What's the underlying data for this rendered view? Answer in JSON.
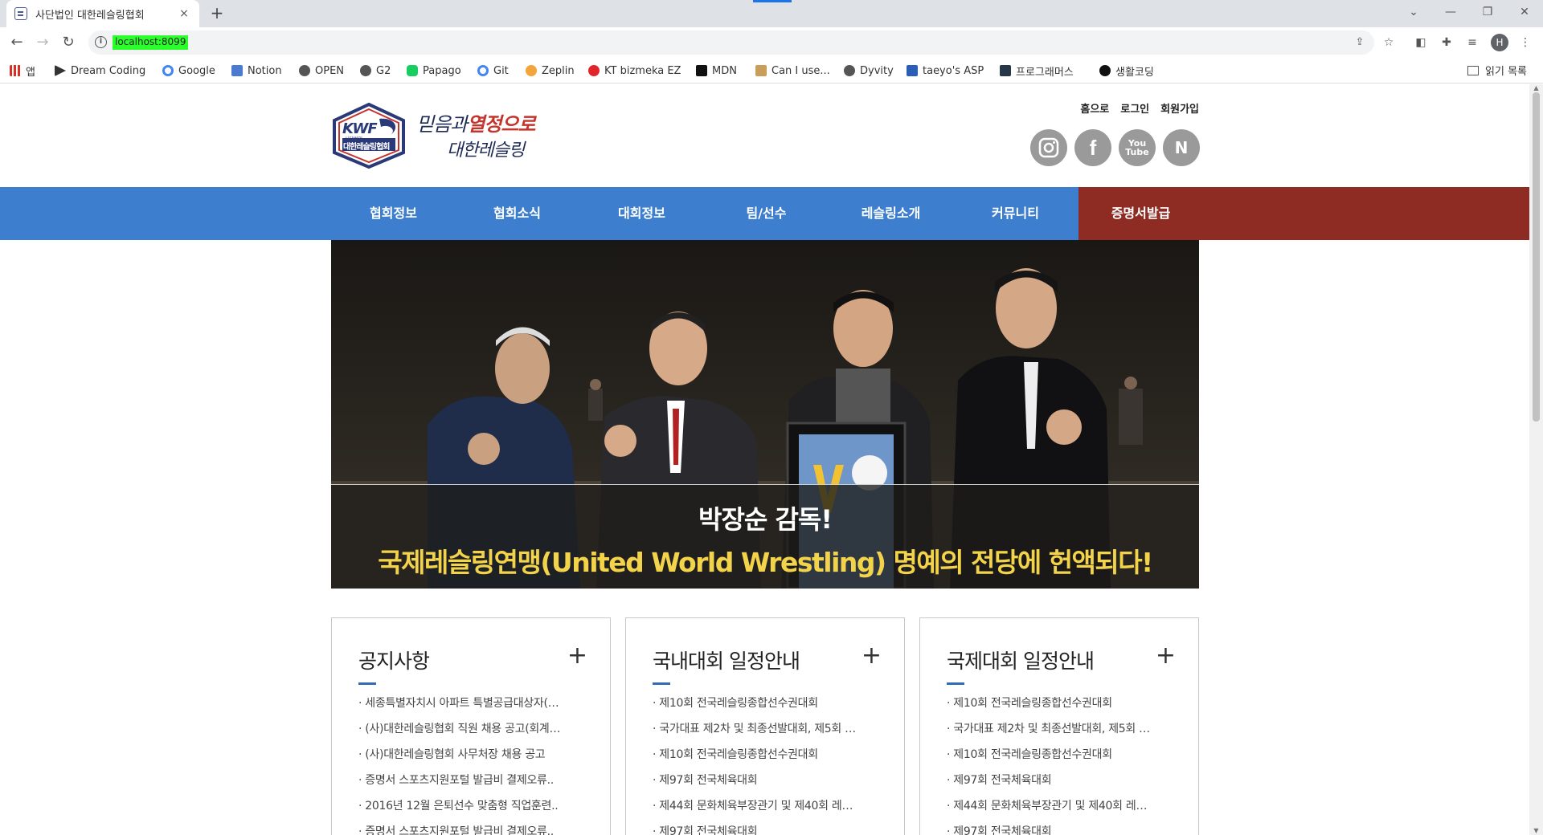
{
  "browser": {
    "tab_title": "사단법인 대한레슬링협회",
    "tab_close": "×",
    "new_tab": "+",
    "url": "localhost:8099",
    "profile_initial": "H",
    "bookmarks": [
      {
        "label": "앱",
        "icon": "apps-grid-icon"
      },
      {
        "label": "Dream Coding",
        "icon": "dream-coding-icon"
      },
      {
        "label": "Google",
        "icon": "google-icon"
      },
      {
        "label": "Notion",
        "icon": "notion-icon"
      },
      {
        "label": "OPEN",
        "icon": "globe-icon"
      },
      {
        "label": "G2",
        "icon": "globe-icon"
      },
      {
        "label": "Papago",
        "icon": "papago-icon"
      },
      {
        "label": "Git",
        "icon": "google-icon"
      },
      {
        "label": "Zeplin",
        "icon": "zeplin-icon"
      },
      {
        "label": "KT bizmeka EZ",
        "icon": "kt-icon"
      },
      {
        "label": "MDN",
        "icon": "mdn-icon"
      },
      {
        "label": "Can I use...",
        "icon": "caniuse-icon"
      },
      {
        "label": "Dyvity",
        "icon": "globe-icon"
      },
      {
        "label": "taeyo's ASP",
        "icon": "taeyo-icon"
      },
      {
        "label": "프로그래머스",
        "icon": "programmers-icon"
      },
      {
        "label": "생활코딩",
        "icon": "circle-icon"
      }
    ],
    "reading_list": "읽기 목록"
  },
  "header": {
    "logo_text": "KWF",
    "logo_sub": "사단법인",
    "logo_name": "대한레슬링협회",
    "slogan_line1_a": "믿음과",
    "slogan_line1_b": "열정으로",
    "slogan_line2": "대한레슬링",
    "top_links": [
      "홈으로",
      "로그인",
      "회원가입"
    ],
    "social": [
      {
        "name": "instagram",
        "glyph": "◎"
      },
      {
        "name": "facebook",
        "glyph": "f"
      },
      {
        "name": "youtube",
        "glyph": "You\nTube"
      },
      {
        "name": "naver",
        "glyph": "N"
      }
    ]
  },
  "nav": {
    "items": [
      "협회정보",
      "협회소식",
      "대회정보",
      "팀/선수",
      "레슬링소개",
      "커뮤니티",
      "증명서발급"
    ]
  },
  "hero": {
    "line1": "박장순 감독!",
    "line2": "국제레슬링연맹(United World Wrestling) 명예의 전당에 헌액되다!"
  },
  "boards": [
    {
      "title": "공지사항",
      "more": "+",
      "items": [
        "· 세종특별자치시 아파트 특별공급대상자(…",
        "· (사)대한레슬링협회 직원 채용 공고(회계…",
        "· (사)대한레슬링협회 사무처장 채용 공고",
        "· 증명서 스포츠지원포털 발급비 결제오류..",
        "· 2016년 12월 은퇴선수 맞춤형 직업훈련..",
        "· 증명서 스포츠지원포털 발급비 결제오류.."
      ]
    },
    {
      "title": "국내대회 일정안내",
      "more": "+",
      "items": [
        "· 제10회 전국레슬링종합선수권대회",
        "· 국가대표 제2차 및 최종선발대회, 제5회 …",
        "· 제10회 전국레슬링종합선수권대회",
        "· 제97회 전국체육대회",
        "· 제44회 문화체육부장관기 및 제40회 레…",
        "· 제97회 전국체육대회"
      ]
    },
    {
      "title": "국제대회 일정안내",
      "more": "+",
      "items": [
        "· 제10회 전국레슬링종합선수권대회",
        "· 국가대표 제2차 및 최종선발대회, 제5회 …",
        "· 제10회 전국레슬링종합선수권대회",
        "· 제97회 전국체육대회",
        "· 제44회 문화체육부장관기 및 제40회 레…",
        "· 제97회 전국체육대회"
      ]
    }
  ]
}
